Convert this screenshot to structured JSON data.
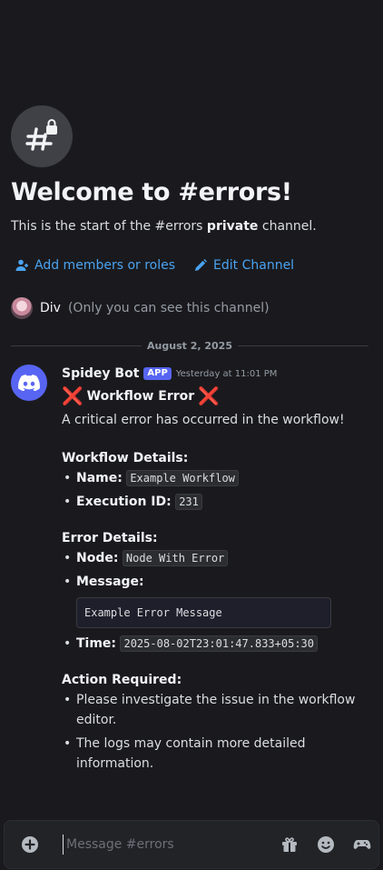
{
  "channel": {
    "welcome_title": "Welcome to #errors!",
    "sub_prefix": "This is the start of the #errors ",
    "sub_bold": "private",
    "sub_suffix": " channel.",
    "add_members_label": "Add members or roles",
    "edit_channel_label": "Edit Channel",
    "visibility_user": "Div",
    "visibility_note": "(Only you can see this channel)"
  },
  "divider": {
    "date": "August 2, 2025"
  },
  "message": {
    "author": "Spidey Bot",
    "badge": "APP",
    "timestamp": "Yesterday at 11:01 PM",
    "title_cross_left": "❌",
    "title": "Workflow Error",
    "title_cross_right": "❌",
    "intro": "A critical error has occurred in the workflow!",
    "workflow_details_heading": "Workflow Details:",
    "name_label": "Name:",
    "name_value": "Example Workflow",
    "exec_label": "Execution ID:",
    "exec_value": "231",
    "error_details_heading": "Error Details:",
    "node_label": "Node:",
    "node_value": "Node With Error",
    "message_label": "Message:",
    "message_value": "Example Error Message",
    "time_label": "Time:",
    "time_value": "2025-08-02T23:01:47.833+05:30",
    "action_heading": "Action Required:",
    "action_1": "Please investigate the issue in the workflow editor.",
    "action_2": "The logs may contain more detailed information."
  },
  "composer": {
    "placeholder": "Message #errors",
    "icons": [
      "plus-circle-icon",
      "gift-icon",
      "emoji-icon",
      "gamepad-icon"
    ]
  },
  "colors": {
    "background": "#1a1a1e",
    "link": "#4aa3f0",
    "brand": "#5865f2",
    "error_cross": "#dd2e44"
  }
}
